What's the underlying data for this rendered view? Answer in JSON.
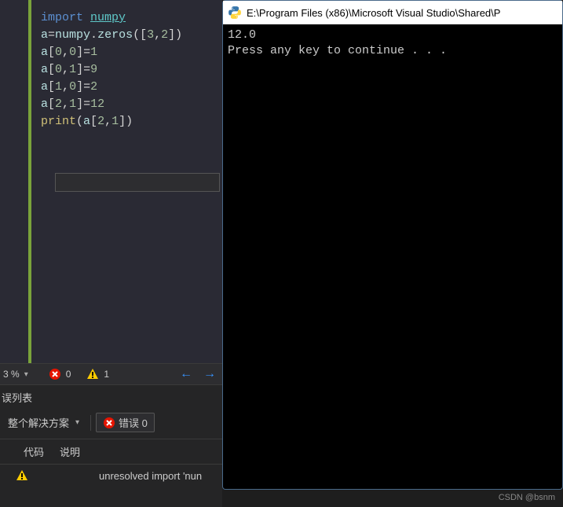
{
  "editor": {
    "code_lines": [
      {
        "tokens": [
          {
            "t": "import ",
            "c": "kw"
          },
          {
            "t": "numpy",
            "c": "mod"
          }
        ]
      },
      {
        "tokens": [
          {
            "t": "a",
            "c": "ident"
          },
          {
            "t": "=",
            "c": "punc"
          },
          {
            "t": "numpy",
            "c": "ident"
          },
          {
            "t": ".",
            "c": "punc"
          },
          {
            "t": "zeros",
            "c": "ident"
          },
          {
            "t": "([",
            "c": "punc"
          },
          {
            "t": "3",
            "c": "num"
          },
          {
            "t": ",",
            "c": "punc"
          },
          {
            "t": "2",
            "c": "num"
          },
          {
            "t": "])",
            "c": "punc"
          }
        ]
      },
      {
        "tokens": [
          {
            "t": "a",
            "c": "ident"
          },
          {
            "t": "[",
            "c": "punc"
          },
          {
            "t": "0",
            "c": "num"
          },
          {
            "t": ",",
            "c": "punc"
          },
          {
            "t": "0",
            "c": "num"
          },
          {
            "t": "]=",
            "c": "punc"
          },
          {
            "t": "1",
            "c": "num"
          }
        ]
      },
      {
        "tokens": [
          {
            "t": "a",
            "c": "ident"
          },
          {
            "t": "[",
            "c": "punc"
          },
          {
            "t": "0",
            "c": "num"
          },
          {
            "t": ",",
            "c": "punc"
          },
          {
            "t": "1",
            "c": "num"
          },
          {
            "t": "]=",
            "c": "punc"
          },
          {
            "t": "9",
            "c": "num"
          }
        ]
      },
      {
        "tokens": [
          {
            "t": "a",
            "c": "ident"
          },
          {
            "t": "[",
            "c": "punc"
          },
          {
            "t": "1",
            "c": "num"
          },
          {
            "t": ",",
            "c": "punc"
          },
          {
            "t": "0",
            "c": "num"
          },
          {
            "t": "]=",
            "c": "punc"
          },
          {
            "t": "2",
            "c": "num"
          }
        ]
      },
      {
        "tokens": [
          {
            "t": "a",
            "c": "ident"
          },
          {
            "t": "[",
            "c": "punc"
          },
          {
            "t": "2",
            "c": "num"
          },
          {
            "t": ",",
            "c": "punc"
          },
          {
            "t": "1",
            "c": "num"
          },
          {
            "t": "]=",
            "c": "punc"
          },
          {
            "t": "12",
            "c": "num"
          }
        ]
      },
      {
        "tokens": [
          {
            "t": "print",
            "c": "func"
          },
          {
            "t": "(",
            "c": "punc"
          },
          {
            "t": "a",
            "c": "ident"
          },
          {
            "t": "[",
            "c": "punc"
          },
          {
            "t": "2",
            "c": "num"
          },
          {
            "t": ",",
            "c": "punc"
          },
          {
            "t": "1",
            "c": "num"
          },
          {
            "t": "])",
            "c": "punc"
          }
        ]
      }
    ]
  },
  "statusbar": {
    "zoom": "3 %",
    "error_count": "0",
    "warn_count": "1"
  },
  "errorlist": {
    "title": "误列表",
    "scope": "整个解决方案",
    "err_btn": "错误 0",
    "col_code": "代码",
    "col_desc": "说明",
    "row_msg": "unresolved import 'nun"
  },
  "console": {
    "title": "E:\\Program Files (x86)\\Microsoft Visual Studio\\Shared\\P",
    "line1": "12.0",
    "line2": "Press any key to continue . . ."
  },
  "watermark": "CSDN @bsnm"
}
